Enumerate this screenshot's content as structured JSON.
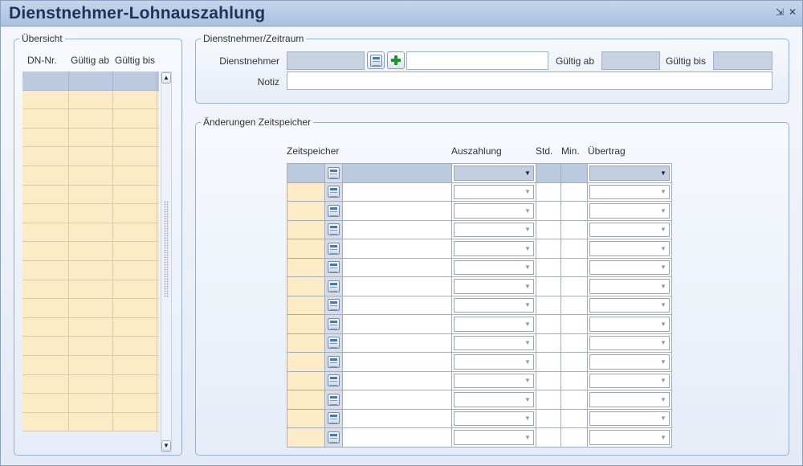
{
  "window": {
    "title": "Dienstnehmer-Lohnauszahlung",
    "minimize_icon": "minimize-icon",
    "close_icon": "close-icon"
  },
  "overview": {
    "legend": "Übersicht",
    "columns": [
      "DN-Nr.",
      "Gültig ab",
      "Gültig bis"
    ],
    "row_count": 19
  },
  "employee_period": {
    "legend": "Dienstnehmer/Zeitraum",
    "employee_label": "Dienstnehmer",
    "employee_value": "",
    "employee_name": "",
    "valid_from_label": "Gültig ab",
    "valid_from_value": "",
    "valid_to_label": "Gültig bis",
    "valid_to_value": "",
    "note_label": "Notiz",
    "note_value": ""
  },
  "time_account_changes": {
    "legend": "Änderungen Zeitspeicher",
    "columns": {
      "time_account": "Zeitspeicher",
      "payout": "Auszahlung",
      "hours": "Std.",
      "minutes": "Min.",
      "carryover": "Übertrag"
    },
    "row_count": 15
  },
  "colors": {
    "title_bar": "#a9c0df",
    "selected_row": "#bccadf",
    "editable_cell": "#fdebc5",
    "title_text": "#1b3558"
  }
}
